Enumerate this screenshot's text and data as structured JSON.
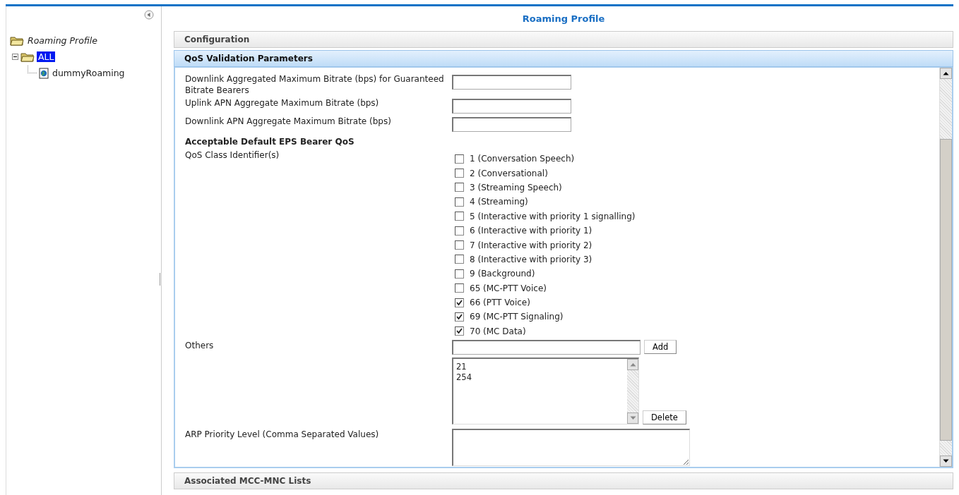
{
  "sidebar": {
    "tree": [
      {
        "label": "Roaming Profile",
        "kind": "folder",
        "selected": false,
        "children": [
          {
            "label": "ALL",
            "kind": "folder",
            "expanded": true,
            "selected": true,
            "children": [
              {
                "label": "dummyRoaming",
                "kind": "file",
                "selected": false
              }
            ]
          }
        ]
      }
    ]
  },
  "page_title": "Roaming Profile",
  "sections": [
    {
      "title": "Configuration",
      "expanded": false
    },
    {
      "title": "QoS Validation Parameters",
      "expanded": true
    },
    {
      "title": "Associated MCC-MNC Lists",
      "expanded": false
    }
  ],
  "qos": {
    "fields": [
      {
        "label": "Downlink Aggregated Maximum Bitrate (bps) for Guaranteed Bitrate Bearers"
      },
      {
        "label": "Uplink APN Aggregate Maximum Bitrate (bps)"
      },
      {
        "label": "Downlink APN Aggregate Maximum Bitrate (bps)"
      }
    ],
    "subheading": "Acceptable Default EPS Bearer QoS",
    "class_label": "QoS Class Identifier(s)",
    "classes": [
      {
        "label": "1 (Conversation Speech)",
        "checked": false
      },
      {
        "label": "2 (Conversational)",
        "checked": false
      },
      {
        "label": "3 (Streaming Speech)",
        "checked": false
      },
      {
        "label": "4 (Streaming)",
        "checked": false
      },
      {
        "label": "5 (Interactive with priority 1 signalling)",
        "checked": false
      },
      {
        "label": "6 (Interactive with priority 1)",
        "checked": false
      },
      {
        "label": "7 (Interactive with priority 2)",
        "checked": false
      },
      {
        "label": "8 (Interactive with priority 3)",
        "checked": false
      },
      {
        "label": "9 (Background)",
        "checked": false
      },
      {
        "label": "65 (MC-PTT Voice)",
        "checked": false
      },
      {
        "label": "66 (PTT Voice)",
        "checked": true
      },
      {
        "label": "69 (MC-PTT Signaling)",
        "checked": true
      },
      {
        "label": "70 (MC Data)",
        "checked": true
      }
    ],
    "others": {
      "label": "Others",
      "add_button": "Add",
      "list": [
        "21",
        "254"
      ],
      "delete_button": "Delete"
    },
    "arp": {
      "label": "ARP Priority Level (Comma Separated Values)"
    }
  }
}
